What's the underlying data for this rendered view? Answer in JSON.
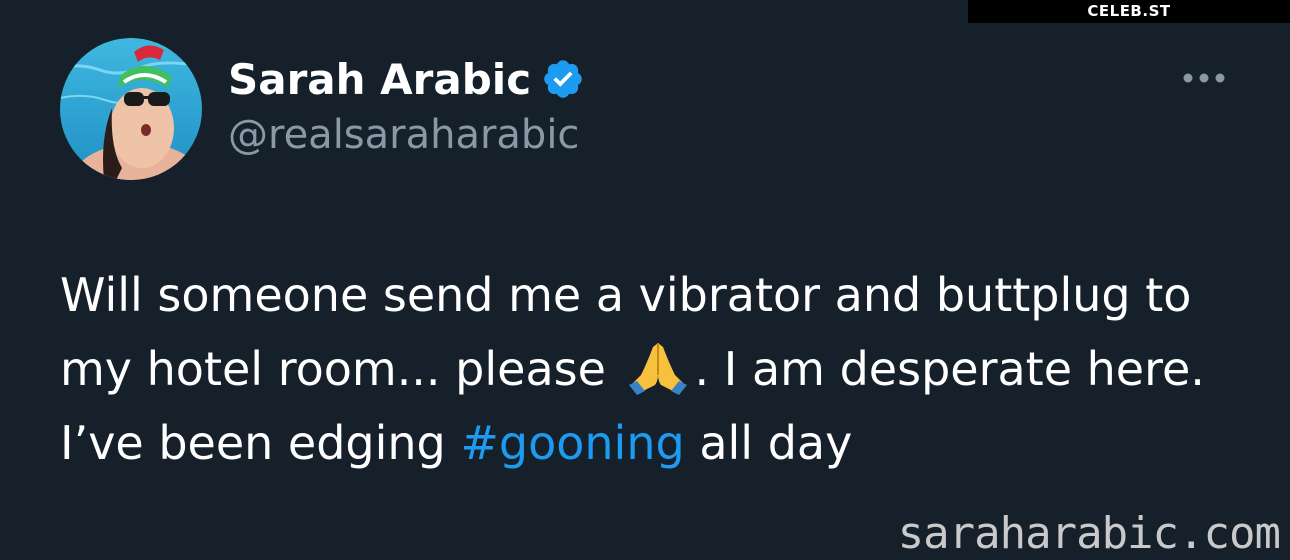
{
  "watermark_top": "CELEB.ST",
  "watermark_bottom": "saraharabic.com",
  "tweet": {
    "display_name": "Sarah Arabic",
    "handle": "@realsaraharabic",
    "verified": true,
    "text_line_1": "Will someone send me a vibrator and buttplug to",
    "text_line_2_before_emoji": "my hotel room... please ",
    "emoji": "folded-hands-emoji",
    "text_line_2_after_emoji": ". I am desperate here.",
    "text_line_3_before_hashtag": "I’ve been edging ",
    "hashtag": "#gooning",
    "text_line_3_after_hashtag": " all day"
  },
  "icons": {
    "verified": "verified-badge-icon",
    "more": "more-dots-icon"
  },
  "colors": {
    "background": "#15202b",
    "text": "#ffffff",
    "secondary_text": "#8b98a5",
    "accent": "#1d9bf0"
  }
}
